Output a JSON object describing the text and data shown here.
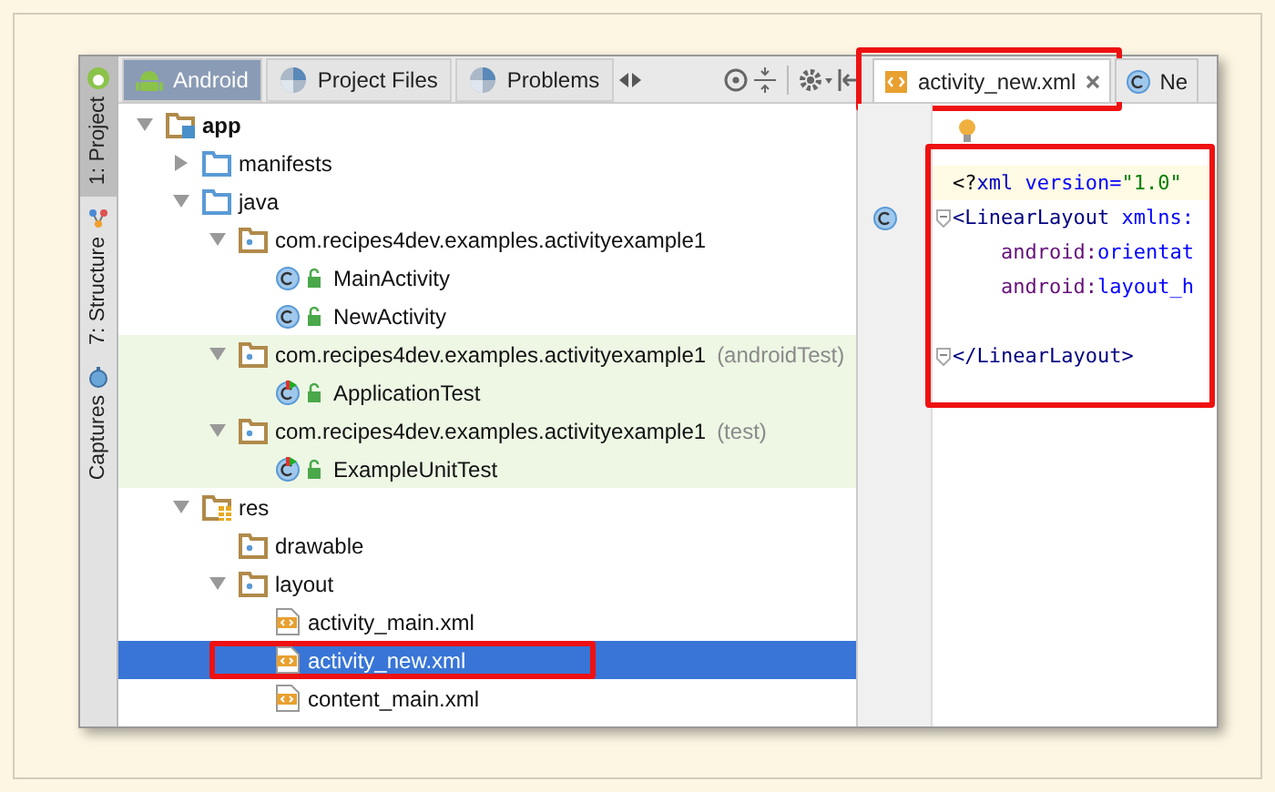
{
  "side_tabs": [
    {
      "label": "1: Project",
      "selected": true
    },
    {
      "label": "7: Structure",
      "selected": false
    },
    {
      "label": "Captures",
      "selected": false
    }
  ],
  "view_tabs": [
    {
      "label": "Android",
      "selected": true
    },
    {
      "label": "Project Files",
      "selected": false
    },
    {
      "label": "Problems",
      "selected": false
    }
  ],
  "tree": [
    {
      "label": "app",
      "kind": "module",
      "bold": true,
      "expanded": true,
      "children": [
        {
          "label": "manifests",
          "kind": "folder",
          "expanded": false
        },
        {
          "label": "java",
          "kind": "folder",
          "expanded": true,
          "children": [
            {
              "label": "com.recipes4dev.examples.activityexample1",
              "kind": "package",
              "expanded": true,
              "test_scope": false,
              "children": [
                {
                  "label": "MainActivity",
                  "kind": "class"
                },
                {
                  "label": "NewActivity",
                  "kind": "class"
                }
              ]
            },
            {
              "label": "com.recipes4dev.examples.activityexample1",
              "suffix": "(androidTest)",
              "kind": "package",
              "expanded": true,
              "test_scope": true,
              "children": [
                {
                  "label": "ApplicationTest",
                  "kind": "test"
                }
              ]
            },
            {
              "label": "com.recipes4dev.examples.activityexample1",
              "suffix": "(test)",
              "kind": "package",
              "expanded": true,
              "test_scope": true,
              "children": [
                {
                  "label": "ExampleUnitTest",
                  "kind": "test"
                }
              ]
            }
          ]
        },
        {
          "label": "res",
          "kind": "res",
          "expanded": true,
          "children": [
            {
              "label": "drawable",
              "kind": "package"
            },
            {
              "label": "layout",
              "kind": "package",
              "expanded": true,
              "children": [
                {
                  "label": "activity_main.xml",
                  "kind": "xml",
                  "selected": false,
                  "annotated": false
                },
                {
                  "label": "activity_new.xml",
                  "kind": "xml",
                  "selected": true,
                  "annotated": true
                },
                {
                  "label": "content_main.xml",
                  "kind": "xml",
                  "selected": false,
                  "annotated": false
                }
              ]
            }
          ]
        }
      ]
    }
  ],
  "editor_tabs": [
    {
      "label": "activity_new.xml",
      "kind": "xml",
      "selected": true,
      "closable": true,
      "annotated": true
    },
    {
      "label": "Ne",
      "kind": "class",
      "selected": false,
      "closable": false,
      "annotated": false
    }
  ],
  "code": {
    "annotated": true,
    "lines": [
      {
        "kind": "code",
        "current": true,
        "segments": [
          {
            "t": "<?",
            "kind": "punct"
          },
          {
            "t": "xml",
            "kind": "name"
          },
          {
            "t": " version=",
            "kind": "attr"
          },
          {
            "t": "\"1.0\"",
            "kind": "value"
          }
        ]
      },
      {
        "kind": "code",
        "current": false,
        "fold": true,
        "class_marker": true,
        "segments": [
          {
            "t": "<LinearLayout",
            "kind": "tag"
          },
          {
            "t": " xmlns:",
            "kind": "attr"
          }
        ]
      },
      {
        "kind": "code",
        "current": false,
        "segments": [
          {
            "t": "    android:",
            "kind": "ns"
          },
          {
            "t": "orientat",
            "kind": "attr"
          }
        ]
      },
      {
        "kind": "code",
        "current": false,
        "segments": [
          {
            "t": "    android:",
            "kind": "ns"
          },
          {
            "t": "layout_h",
            "kind": "attr"
          }
        ]
      },
      {
        "kind": "blank"
      },
      {
        "kind": "code",
        "current": false,
        "fold": true,
        "segments": [
          {
            "t": "</LinearLayout>",
            "kind": "tag"
          }
        ]
      }
    ]
  }
}
